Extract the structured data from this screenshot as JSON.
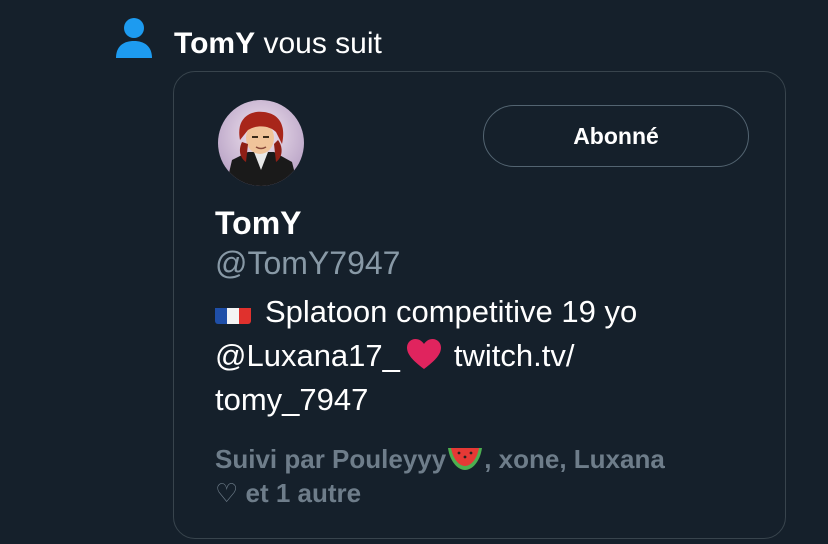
{
  "notification": {
    "username": "TomY",
    "action": " vous suit",
    "icon": "person-icon",
    "icon_color": "#1d9bf0"
  },
  "profile_card": {
    "avatar": "avatar",
    "follow_button_label": "Abonné",
    "display_name": "TomY",
    "handle": "@TomY7947",
    "bio": {
      "flag_icon": "france-flag-icon",
      "line1_text": "Splatoon competitive 19 yo",
      "mention": "@Luxana17_",
      "heart_icon": "red-heart-icon",
      "link_part1": "twitch.tv/",
      "link_part2": "tomy_7947"
    },
    "followed_by": {
      "prefix": "Suivi par Pouleyyy",
      "emoji_icon": "watermelon-icon",
      "suffix": ", xone, Luxana",
      "line2_heart": "♡",
      "line2_text": " et 1 autre"
    }
  },
  "colors": {
    "background": "#15202b",
    "border": "#38444d",
    "secondary_text": "#8899a6",
    "muted_text": "#6e7d8a",
    "accent": "#1d9bf0",
    "heart": "#e0245e"
  }
}
